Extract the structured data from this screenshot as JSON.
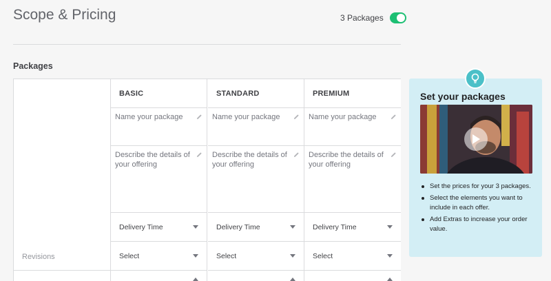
{
  "header": {
    "title": "Scope & Pricing",
    "packages_toggle_label": "3 Packages",
    "packages_toggle_on": true
  },
  "section": {
    "label": "Packages"
  },
  "table": {
    "columns": [
      {
        "title": "BASIC",
        "name_placeholder": "Name your package",
        "desc_placeholder": "Describe the details of your offering",
        "delivery": "Delivery Time",
        "revisions": "Select"
      },
      {
        "title": "STANDARD",
        "name_placeholder": "Name your package",
        "desc_placeholder": "Describe the details of your offering",
        "delivery": "Delivery Time",
        "revisions": "Select"
      },
      {
        "title": "PREMIUM",
        "name_placeholder": "Name your package",
        "desc_placeholder": "Describe the details of your offering",
        "delivery": "Delivery Time",
        "revisions": "Select"
      }
    ],
    "row_labels": {
      "revisions": "Revisions"
    }
  },
  "tip": {
    "title": "Set your packages",
    "items": [
      "Set the prices for your 3 packages.",
      "Select the elements you want to include in each offer.",
      "Add Extras to increase your order value."
    ]
  },
  "colors": {
    "accent_green": "#1dbf73",
    "tip_background": "#d3eef5",
    "bulb_badge": "#4bc0c8"
  },
  "icons": {
    "edit": "pencil-icon",
    "dropdown": "caret-down-icon",
    "tip_badge": "lightbulb-icon",
    "video": "play-icon"
  }
}
